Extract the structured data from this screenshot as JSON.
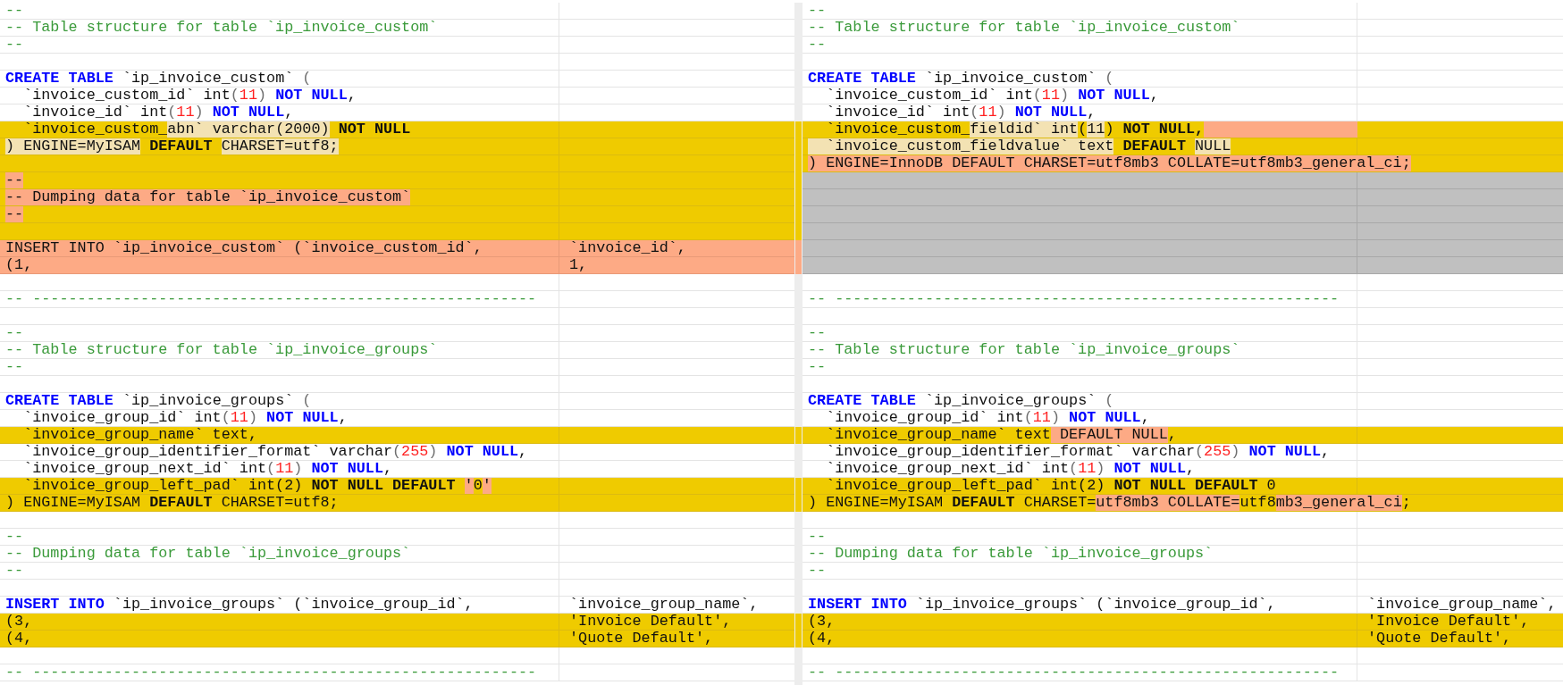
{
  "panes": [
    {
      "rows": [
        {
          "kind": "same",
          "line": [
            {
              "text": "--",
              "kind": "comment"
            }
          ]
        },
        {
          "kind": "same",
          "line": [
            {
              "text": "-- Table structure for table `ip_invoice_custom`",
              "kind": "comment"
            }
          ]
        },
        {
          "kind": "same",
          "line": [
            {
              "text": "--",
              "kind": "comment"
            }
          ]
        },
        {
          "kind": "same"
        },
        {
          "kind": "same",
          "line": [
            {
              "text": "CREATE TABLE",
              "kind": "keyword"
            },
            {
              "text": " `ip_invoice_custom` ",
              "kind": "plain"
            },
            {
              "text": "(",
              "kind": "paren"
            }
          ]
        },
        {
          "kind": "same",
          "line": [
            {
              "text": "  `invoice_custom_id` int",
              "kind": "plain"
            },
            {
              "text": "(",
              "kind": "paren"
            },
            {
              "text": "11",
              "kind": "number"
            },
            {
              "text": ") ",
              "kind": "paren"
            },
            {
              "text": "NOT NULL",
              "kind": "keyword"
            },
            {
              "text": ",",
              "kind": "plain"
            }
          ]
        },
        {
          "kind": "same",
          "line": [
            {
              "text": "  `invoice_id` int",
              "kind": "plain"
            },
            {
              "text": "(",
              "kind": "paren"
            },
            {
              "text": "11",
              "kind": "number"
            },
            {
              "text": ") ",
              "kind": "paren"
            },
            {
              "text": "NOT NULL",
              "kind": "keyword"
            },
            {
              "text": ",",
              "kind": "plain"
            }
          ]
        },
        {
          "kind": "changed",
          "line": [
            {
              "text": "  `invoice_custom_",
              "kind": "plain"
            },
            {
              "text": "abn`",
              "kind": "moved"
            },
            {
              "text": " varchar(2000)",
              "kind": "moved"
            },
            {
              "text": " NOT NULL",
              "kind": "bold"
            }
          ]
        },
        {
          "kind": "changed",
          "line": [
            {
              "text": ")",
              "kind": "moved"
            },
            {
              "text": " ENGINE=MyISAM",
              "kind": "moved"
            },
            {
              "text": " DEFAULT ",
              "kind": "bold"
            },
            {
              "text": "CHARSET=utf8;",
              "kind": "moved"
            }
          ]
        },
        {
          "kind": "changed"
        },
        {
          "kind": "changed",
          "line": [
            {
              "text": "--",
              "kind": "added"
            }
          ]
        },
        {
          "kind": "changed",
          "line": [
            {
              "text": "-- Dumping data for table `ip_invoice_custom`",
              "kind": "added"
            }
          ]
        },
        {
          "kind": "changed",
          "line": [
            {
              "text": "--",
              "kind": "added"
            }
          ]
        },
        {
          "kind": "changed"
        },
        {
          "kind": "deleted",
          "line": [
            {
              "text": "INSERT INTO `ip_invoice_custom` (`invoice_custom_id`,",
              "kind": "plain"
            }
          ],
          "column_2": [
            {
              "text": "`invoice_id`,",
              "kind": "plain"
            }
          ]
        },
        {
          "kind": "deleted",
          "line": [
            {
              "text": "(1,",
              "kind": "plain"
            }
          ],
          "column_2": [
            {
              "text": "1,",
              "kind": "plain"
            }
          ]
        },
        {
          "kind": "same"
        },
        {
          "kind": "same",
          "line": [
            {
              "text": "-- --------------------------------------------------------",
              "kind": "comment"
            }
          ]
        },
        {
          "kind": "same"
        },
        {
          "kind": "same",
          "line": [
            {
              "text": "--",
              "kind": "comment"
            }
          ]
        },
        {
          "kind": "same",
          "line": [
            {
              "text": "-- Table structure for table `ip_invoice_groups`",
              "kind": "comment"
            }
          ]
        },
        {
          "kind": "same",
          "line": [
            {
              "text": "--",
              "kind": "comment"
            }
          ]
        },
        {
          "kind": "same"
        },
        {
          "kind": "same",
          "line": [
            {
              "text": "CREATE TABLE",
              "kind": "keyword"
            },
            {
              "text": " `ip_invoice_groups` ",
              "kind": "plain"
            },
            {
              "text": "(",
              "kind": "paren"
            }
          ]
        },
        {
          "kind": "same",
          "line": [
            {
              "text": "  `invoice_group_id` int",
              "kind": "plain"
            },
            {
              "text": "(",
              "kind": "paren"
            },
            {
              "text": "11",
              "kind": "number"
            },
            {
              "text": ") ",
              "kind": "paren"
            },
            {
              "text": "NOT NULL",
              "kind": "keyword"
            },
            {
              "text": ",",
              "kind": "plain"
            }
          ]
        },
        {
          "kind": "changed",
          "line": [
            {
              "text": "  `invoice_group_name` text,",
              "kind": "plain"
            }
          ]
        },
        {
          "kind": "same",
          "line": [
            {
              "text": "  `invoice_group_identifier_format` varchar",
              "kind": "plain"
            },
            {
              "text": "(",
              "kind": "paren"
            },
            {
              "text": "255",
              "kind": "number"
            },
            {
              "text": ") ",
              "kind": "paren"
            },
            {
              "text": "NOT NULL",
              "kind": "keyword"
            },
            {
              "text": ",",
              "kind": "plain"
            }
          ]
        },
        {
          "kind": "same",
          "line": [
            {
              "text": "  `invoice_group_next_id` int",
              "kind": "plain"
            },
            {
              "text": "(",
              "kind": "paren"
            },
            {
              "text": "11",
              "kind": "number"
            },
            {
              "text": ") ",
              "kind": "paren"
            },
            {
              "text": "NOT NULL",
              "kind": "keyword"
            },
            {
              "text": ",",
              "kind": "plain"
            }
          ]
        },
        {
          "kind": "changed",
          "line": [
            {
              "text": "  `invoice_group_left_pad` int(2) ",
              "kind": "plain"
            },
            {
              "text": "NOT NULL DEFAULT ",
              "kind": "bold"
            },
            {
              "text": "'",
              "kind": "added"
            },
            {
              "text": "0",
              "kind": "plain"
            },
            {
              "text": "'",
              "kind": "added"
            }
          ]
        },
        {
          "kind": "changed",
          "line": [
            {
              "text": ") ENGINE=MyISAM ",
              "kind": "plain"
            },
            {
              "text": "DEFAULT",
              "kind": "bold"
            },
            {
              "text": " CHARSET=utf8;",
              "kind": "plain"
            }
          ]
        },
        {
          "kind": "same"
        },
        {
          "kind": "same",
          "line": [
            {
              "text": "--",
              "kind": "comment"
            }
          ]
        },
        {
          "kind": "same",
          "line": [
            {
              "text": "-- Dumping data for table `ip_invoice_groups`",
              "kind": "comment"
            }
          ]
        },
        {
          "kind": "same",
          "line": [
            {
              "text": "--",
              "kind": "comment"
            }
          ]
        },
        {
          "kind": "same"
        },
        {
          "kind": "same",
          "line": [
            {
              "text": "INSERT INTO",
              "kind": "keyword"
            },
            {
              "text": " `ip_invoice_groups` (`invoice_group_id`,",
              "kind": "plain"
            }
          ],
          "column_2": [
            {
              "text": "`invoice_group_name`,",
              "kind": "plain"
            }
          ]
        },
        {
          "kind": "changed",
          "line": [
            {
              "text": "(3,",
              "kind": "plain"
            }
          ],
          "column_2": [
            {
              "text": "'Invoice Default',",
              "kind": "plain"
            }
          ]
        },
        {
          "kind": "changed",
          "line": [
            {
              "text": "(4,",
              "kind": "plain"
            }
          ],
          "column_2": [
            {
              "text": "'Quote Default',",
              "kind": "plain"
            }
          ]
        },
        {
          "kind": "same"
        },
        {
          "kind": "same",
          "line": [
            {
              "text": "-- --------------------------------------------------------",
              "kind": "comment"
            }
          ]
        }
      ]
    },
    {
      "rows": [
        {
          "kind": "same",
          "line": [
            {
              "text": "--",
              "kind": "comment"
            }
          ]
        },
        {
          "kind": "same",
          "line": [
            {
              "text": "-- Table structure for table `ip_invoice_custom`",
              "kind": "comment"
            }
          ]
        },
        {
          "kind": "same",
          "line": [
            {
              "text": "--",
              "kind": "comment"
            }
          ]
        },
        {
          "kind": "same"
        },
        {
          "kind": "same",
          "line": [
            {
              "text": "CREATE TABLE",
              "kind": "keyword"
            },
            {
              "text": " `ip_invoice_custom` ",
              "kind": "plain"
            },
            {
              "text": "(",
              "kind": "paren"
            }
          ]
        },
        {
          "kind": "same",
          "line": [
            {
              "text": "  `invoice_custom_id` int",
              "kind": "plain"
            },
            {
              "text": "(",
              "kind": "paren"
            },
            {
              "text": "11",
              "kind": "number"
            },
            {
              "text": ") ",
              "kind": "paren"
            },
            {
              "text": "NOT NULL",
              "kind": "keyword"
            },
            {
              "text": ",",
              "kind": "plain"
            }
          ]
        },
        {
          "kind": "same",
          "line": [
            {
              "text": "  `invoice_id` int",
              "kind": "plain"
            },
            {
              "text": "(",
              "kind": "paren"
            },
            {
              "text": "11",
              "kind": "number"
            },
            {
              "text": ") ",
              "kind": "paren"
            },
            {
              "text": "NOT NULL",
              "kind": "keyword"
            },
            {
              "text": ",",
              "kind": "plain"
            }
          ]
        },
        {
          "kind": "changed-tail",
          "line": [
            {
              "text": "  `invoice_custom_",
              "kind": "plain"
            },
            {
              "text": "fieldid`",
              "kind": "moved"
            },
            {
              "text": " int",
              "kind": "moved"
            },
            {
              "text": "(",
              "kind": "plain"
            },
            {
              "text": "11",
              "kind": "moved"
            },
            {
              "text": ")",
              "kind": "plain"
            },
            {
              "text": " NOT NULL,",
              "kind": "bold"
            }
          ]
        },
        {
          "kind": "changed",
          "line": [
            {
              "text": "  `invoice_custom_fieldvalue`",
              "kind": "moved"
            },
            {
              "text": " text",
              "kind": "moved"
            },
            {
              "text": " DEFAULT ",
              "kind": "bold"
            },
            {
              "text": "NULL",
              "kind": "moved"
            }
          ]
        },
        {
          "kind": "changed",
          "line": [
            {
              "text": ") ENGINE=InnoDB DEFAULT CHARSET=utf8mb3 COLLATE=utf8mb3_general_ci;",
              "kind": "added"
            }
          ]
        },
        {
          "kind": "filler"
        },
        {
          "kind": "filler"
        },
        {
          "kind": "filler"
        },
        {
          "kind": "filler"
        },
        {
          "kind": "filler"
        },
        {
          "kind": "filler"
        },
        {
          "kind": "same"
        },
        {
          "kind": "same",
          "line": [
            {
              "text": "-- --------------------------------------------------------",
              "kind": "comment"
            }
          ]
        },
        {
          "kind": "same"
        },
        {
          "kind": "same",
          "line": [
            {
              "text": "--",
              "kind": "comment"
            }
          ]
        },
        {
          "kind": "same",
          "line": [
            {
              "text": "-- Table structure for table `ip_invoice_groups`",
              "kind": "comment"
            }
          ]
        },
        {
          "kind": "same",
          "line": [
            {
              "text": "--",
              "kind": "comment"
            }
          ]
        },
        {
          "kind": "same"
        },
        {
          "kind": "same",
          "line": [
            {
              "text": "CREATE TABLE",
              "kind": "keyword"
            },
            {
              "text": " `ip_invoice_groups` ",
              "kind": "plain"
            },
            {
              "text": "(",
              "kind": "paren"
            }
          ]
        },
        {
          "kind": "same",
          "line": [
            {
              "text": "  `invoice_group_id` int",
              "kind": "plain"
            },
            {
              "text": "(",
              "kind": "paren"
            },
            {
              "text": "11",
              "kind": "number"
            },
            {
              "text": ") ",
              "kind": "paren"
            },
            {
              "text": "NOT NULL",
              "kind": "keyword"
            },
            {
              "text": ",",
              "kind": "plain"
            }
          ]
        },
        {
          "kind": "changed",
          "line": [
            {
              "text": "  `invoice_group_name` text",
              "kind": "plain"
            },
            {
              "text": " DEFAULT NULL",
              "kind": "added"
            },
            {
              "text": ",",
              "kind": "plain"
            }
          ]
        },
        {
          "kind": "same",
          "line": [
            {
              "text": "  `invoice_group_identifier_format` varchar",
              "kind": "plain"
            },
            {
              "text": "(",
              "kind": "paren"
            },
            {
              "text": "255",
              "kind": "number"
            },
            {
              "text": ") ",
              "kind": "paren"
            },
            {
              "text": "NOT NULL",
              "kind": "keyword"
            },
            {
              "text": ",",
              "kind": "plain"
            }
          ]
        },
        {
          "kind": "same",
          "line": [
            {
              "text": "  `invoice_group_next_id` int",
              "kind": "plain"
            },
            {
              "text": "(",
              "kind": "paren"
            },
            {
              "text": "11",
              "kind": "number"
            },
            {
              "text": ") ",
              "kind": "paren"
            },
            {
              "text": "NOT NULL",
              "kind": "keyword"
            },
            {
              "text": ",",
              "kind": "plain"
            }
          ]
        },
        {
          "kind": "changed",
          "line": [
            {
              "text": "  `invoice_group_left_pad` int(2) ",
              "kind": "plain"
            },
            {
              "text": "NOT NULL DEFAULT",
              "kind": "bold"
            },
            {
              "text": " 0",
              "kind": "plain"
            }
          ]
        },
        {
          "kind": "changed",
          "line": [
            {
              "text": ") ENGINE=MyISAM ",
              "kind": "plain"
            },
            {
              "text": "DEFAULT",
              "kind": "bold"
            },
            {
              "text": " CHARSET=",
              "kind": "plain"
            },
            {
              "text": "utf8mb3 COLLATE=",
              "kind": "added"
            },
            {
              "text": "utf8",
              "kind": "plain"
            },
            {
              "text": "mb3_general_ci",
              "kind": "added"
            },
            {
              "text": ";",
              "kind": "plain"
            }
          ]
        },
        {
          "kind": "same"
        },
        {
          "kind": "same",
          "line": [
            {
              "text": "--",
              "kind": "comment"
            }
          ]
        },
        {
          "kind": "same",
          "line": [
            {
              "text": "-- Dumping data for table `ip_invoice_groups`",
              "kind": "comment"
            }
          ]
        },
        {
          "kind": "same",
          "line": [
            {
              "text": "--",
              "kind": "comment"
            }
          ]
        },
        {
          "kind": "same"
        },
        {
          "kind": "same",
          "line": [
            {
              "text": "INSERT INTO",
              "kind": "keyword"
            },
            {
              "text": " `ip_invoice_groups` (`invoice_group_id`,",
              "kind": "plain"
            }
          ],
          "column_2": [
            {
              "text": "`invoice_group_name`,",
              "kind": "plain"
            }
          ]
        },
        {
          "kind": "changed",
          "line": [
            {
              "text": "(3,",
              "kind": "plain"
            }
          ],
          "column_2": [
            {
              "text": "'Invoice Default',",
              "kind": "plain"
            }
          ]
        },
        {
          "kind": "changed",
          "line": [
            {
              "text": "(4,",
              "kind": "plain"
            }
          ],
          "column_2": [
            {
              "text": "'Quote Default',",
              "kind": "plain"
            }
          ]
        },
        {
          "kind": "same"
        },
        {
          "kind": "same",
          "line": [
            {
              "text": "-- --------------------------------------------------------",
              "kind": "comment"
            }
          ]
        }
      ]
    }
  ]
}
